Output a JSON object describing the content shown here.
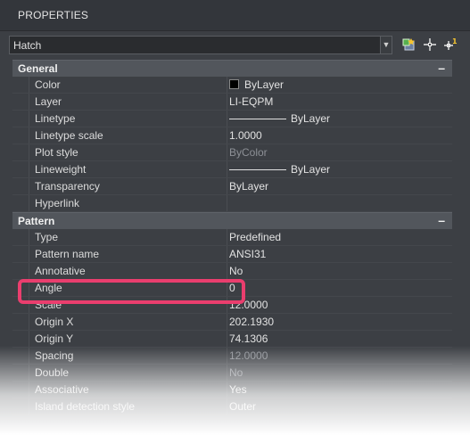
{
  "titlebar": {
    "title": "PROPERTIES"
  },
  "selector": {
    "value": "Hatch"
  },
  "toolbar": {
    "icons": [
      "quick-select-icon",
      "select-objects-icon",
      "pickadd-toggle-icon"
    ]
  },
  "sections": {
    "general": {
      "name": "General",
      "collapse": "–",
      "rows": [
        {
          "label": "Color",
          "value": "ByLayer"
        },
        {
          "label": "Layer",
          "value": "LI-EQPM"
        },
        {
          "label": "Linetype",
          "value": "ByLayer"
        },
        {
          "label": "Linetype scale",
          "value": "1.0000"
        },
        {
          "label": "Plot style",
          "value": "ByColor"
        },
        {
          "label": "Lineweight",
          "value": "ByLayer"
        },
        {
          "label": "Transparency",
          "value": "ByLayer"
        },
        {
          "label": "Hyperlink",
          "value": ""
        }
      ]
    },
    "pattern": {
      "name": "Pattern",
      "collapse": "–",
      "rows": [
        {
          "label": "Type",
          "value": "Predefined"
        },
        {
          "label": "Pattern name",
          "value": "ANSI31"
        },
        {
          "label": "Annotative",
          "value": "No"
        },
        {
          "label": "Angle",
          "value": "0"
        },
        {
          "label": "Scale",
          "value": "12.0000"
        },
        {
          "label": "Origin X",
          "value": "202.1930"
        },
        {
          "label": "Origin Y",
          "value": "74.1306"
        },
        {
          "label": "Spacing",
          "value": "12.0000"
        },
        {
          "label": "Double",
          "value": "No"
        },
        {
          "label": "Associative",
          "value": "Yes"
        },
        {
          "label": "Island detection style",
          "value": "Outer"
        }
      ]
    }
  },
  "colors": {
    "panel_bg": "#3c3f44",
    "section_bg": "#52565c",
    "highlight": "#ea3e6e",
    "color_swatch": "#000000"
  }
}
